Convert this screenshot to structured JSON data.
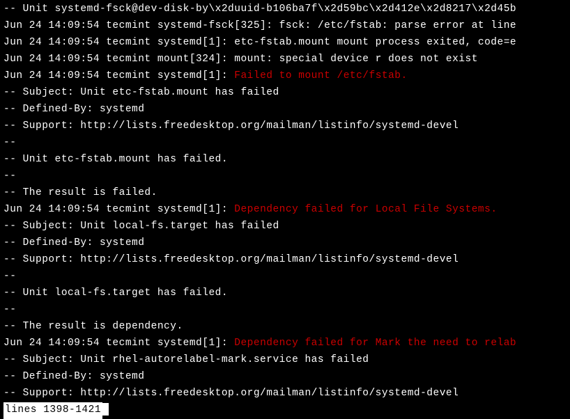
{
  "lines": [
    {
      "text": "-- Unit systemd-fsck@dev-disk-by\\x2duuid-b106ba7f\\x2d59bc\\x2d412e\\x2d8217\\x2d45b",
      "color": "white"
    },
    {
      "text": "Jun 24 14:09:54 tecmint systemd-fsck[325]: fsck: /etc/fstab: parse error at line",
      "color": "white"
    },
    {
      "text": "Jun 24 14:09:54 tecmint systemd[1]: etc-fstab.mount mount process exited, code=e",
      "color": "white"
    },
    {
      "text": "Jun 24 14:09:54 tecmint mount[324]: mount: special device r does not exist",
      "color": "white"
    },
    {
      "prefix": "Jun 24 14:09:54 tecmint systemd[1]: ",
      "highlight": "Failed to mount /etc/fstab.",
      "color": "mixed"
    },
    {
      "text": "-- Subject: Unit etc-fstab.mount has failed",
      "color": "white"
    },
    {
      "text": "-- Defined-By: systemd",
      "color": "white"
    },
    {
      "text": "-- Support: http://lists.freedesktop.org/mailman/listinfo/systemd-devel",
      "color": "white"
    },
    {
      "text": "--",
      "color": "white"
    },
    {
      "text": "-- Unit etc-fstab.mount has failed.",
      "color": "white"
    },
    {
      "text": "--",
      "color": "white"
    },
    {
      "text": "-- The result is failed.",
      "color": "white"
    },
    {
      "prefix": "Jun 24 14:09:54 tecmint systemd[1]: ",
      "highlight": "Dependency failed for Local File Systems.",
      "color": "mixed"
    },
    {
      "text": "-- Subject: Unit local-fs.target has failed",
      "color": "white"
    },
    {
      "text": "-- Defined-By: systemd",
      "color": "white"
    },
    {
      "text": "-- Support: http://lists.freedesktop.org/mailman/listinfo/systemd-devel",
      "color": "white"
    },
    {
      "text": "--",
      "color": "white"
    },
    {
      "text": "-- Unit local-fs.target has failed.",
      "color": "white"
    },
    {
      "text": "--",
      "color": "white"
    },
    {
      "text": "-- The result is dependency.",
      "color": "white"
    },
    {
      "prefix": "Jun 24 14:09:54 tecmint systemd[1]: ",
      "highlight": "Dependency failed for Mark the need to relab",
      "color": "mixed"
    },
    {
      "text": "-- Subject: Unit rhel-autorelabel-mark.service has failed",
      "color": "white"
    },
    {
      "text": "-- Defined-By: systemd",
      "color": "white"
    },
    {
      "text": "-- Support: http://lists.freedesktop.org/mailman/listinfo/systemd-devel",
      "color": "white"
    }
  ],
  "status": "lines 1398-1421"
}
